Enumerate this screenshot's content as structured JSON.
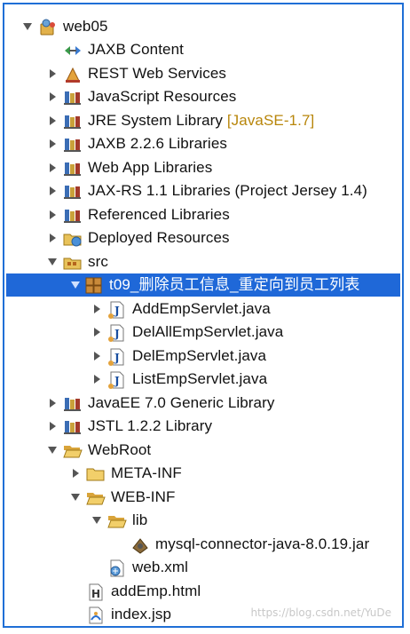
{
  "tree": {
    "rows": [
      {
        "label": "web05",
        "icon": "project-icon"
      },
      {
        "label": "JAXB Content",
        "icon": "jaxb-content-icon"
      },
      {
        "label": "REST Web Services",
        "icon": "rest-services-icon"
      },
      {
        "label": "JavaScript Resources",
        "icon": "library-icon"
      },
      {
        "label": "JRE System Library",
        "decoration": "[JavaSE-1.7]",
        "icon": "library-icon"
      },
      {
        "label": "JAXB 2.2.6 Libraries",
        "icon": "library-icon"
      },
      {
        "label": "Web App Libraries",
        "icon": "library-icon"
      },
      {
        "label": "JAX-RS 1.1 Libraries (Project Jersey 1.4)",
        "icon": "library-icon"
      },
      {
        "label": "Referenced Libraries",
        "icon": "library-icon"
      },
      {
        "label": "Deployed Resources",
        "icon": "deployed-folder-icon"
      },
      {
        "label": "src",
        "icon": "source-folder-icon"
      },
      {
        "label": "t09_删除员工信息_重定向到员工列表",
        "icon": "package-icon"
      },
      {
        "label": "AddEmpServlet.java",
        "icon": "java-file-icon"
      },
      {
        "label": "DelAllEmpServlet.java",
        "icon": "java-file-icon"
      },
      {
        "label": "DelEmpServlet.java",
        "icon": "java-file-icon"
      },
      {
        "label": "ListEmpServlet.java",
        "icon": "java-file-icon"
      },
      {
        "label": "JavaEE 7.0 Generic Library",
        "icon": "library-icon"
      },
      {
        "label": "JSTL 1.2.2 Library",
        "icon": "library-icon"
      },
      {
        "label": "WebRoot",
        "icon": "folder-open-icon"
      },
      {
        "label": "META-INF",
        "icon": "folder-icon"
      },
      {
        "label": "WEB-INF",
        "icon": "folder-open-icon"
      },
      {
        "label": "lib",
        "icon": "folder-open-icon"
      },
      {
        "label": "mysql-connector-java-8.0.19.jar",
        "icon": "jar-icon"
      },
      {
        "label": "web.xml",
        "icon": "xml-file-icon"
      },
      {
        "label": "addEmp.html",
        "icon": "html-file-icon"
      },
      {
        "label": "index.jsp",
        "icon": "jsp-file-icon"
      }
    ]
  },
  "colors": {
    "selection": "#1f68d8",
    "border": "#1f6fd6",
    "decoration": "#b8860b"
  },
  "watermark": "https://blog.csdn.net/YuDe"
}
